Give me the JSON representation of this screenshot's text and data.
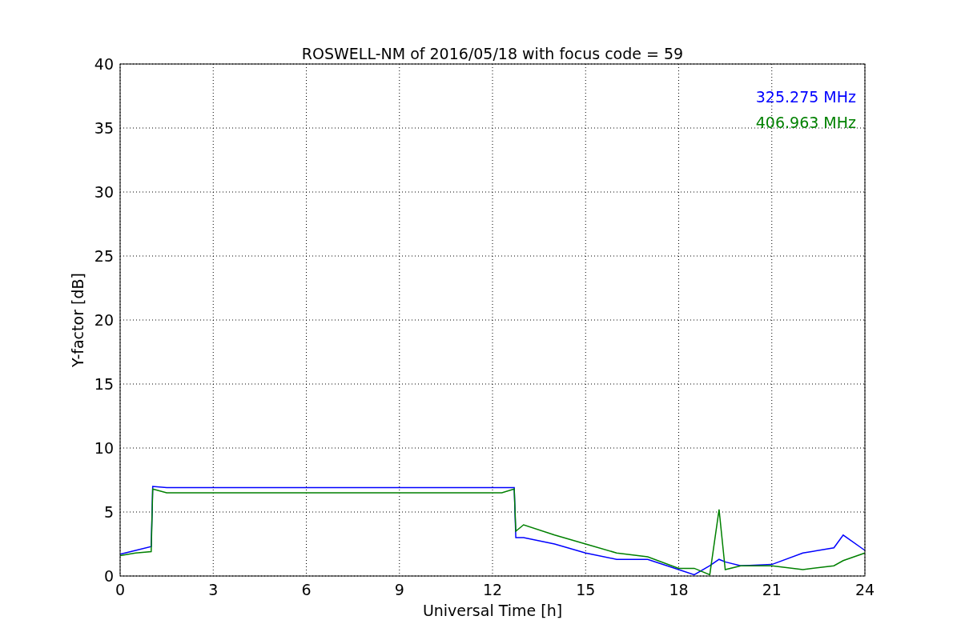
{
  "chart_data": {
    "type": "line",
    "title": "ROSWELL-NM of 2016/05/18 with focus code = 59",
    "xlabel": "Universal Time [h]",
    "ylabel": "Y-factor [dB]",
    "x": [
      0,
      0.5,
      1.0,
      1.05,
      1.5,
      12.3,
      12.7,
      12.75,
      13,
      14,
      15,
      16,
      17,
      18,
      18.5,
      19,
      19.3,
      19.5,
      20,
      21,
      22,
      23,
      23.3,
      24
    ],
    "series": [
      {
        "name": "325.275 MHz",
        "color": "#0000ff",
        "values": [
          1.7,
          2.0,
          2.3,
          7.0,
          6.9,
          6.9,
          6.9,
          3.0,
          3.0,
          2.5,
          1.8,
          1.3,
          1.3,
          0.5,
          0.1,
          0.8,
          1.3,
          1.1,
          0.8,
          0.9,
          1.8,
          2.2,
          3.2,
          2.0
        ]
      },
      {
        "name": "406.963 MHz",
        "color": "#008000",
        "values": [
          1.6,
          1.8,
          1.9,
          6.8,
          6.5,
          6.5,
          6.8,
          3.5,
          4.0,
          3.2,
          2.5,
          1.8,
          1.5,
          0.6,
          0.6,
          0.1,
          5.2,
          0.5,
          0.8,
          0.8,
          0.5,
          0.8,
          1.2,
          1.8
        ]
      }
    ],
    "grid": true,
    "xlim": [
      0,
      24
    ],
    "ylim": [
      0,
      40
    ],
    "xticks": [
      0,
      3,
      6,
      9,
      12,
      15,
      18,
      21,
      24
    ],
    "yticks": [
      0,
      5,
      10,
      15,
      20,
      25,
      30,
      35,
      40
    ]
  }
}
